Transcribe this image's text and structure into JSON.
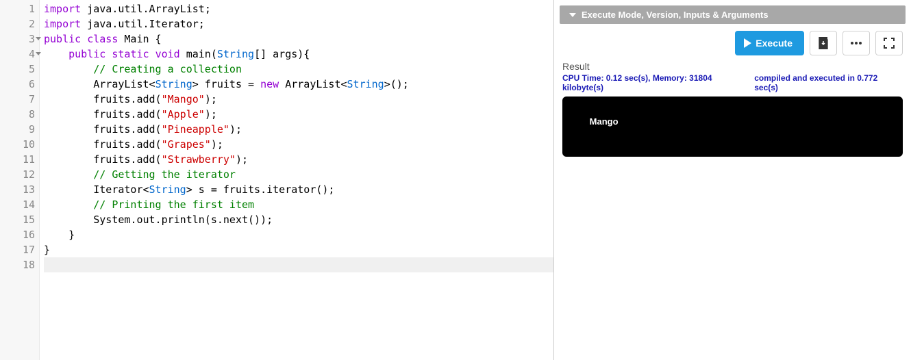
{
  "editor": {
    "lines": [
      {
        "n": "1",
        "fold": false,
        "tokens": [
          {
            "c": "kw-import",
            "t": "import"
          },
          {
            "c": "pn",
            "t": " "
          },
          {
            "c": "pkg",
            "t": "java.util.ArrayList"
          },
          {
            "c": "pn",
            "t": ";"
          }
        ]
      },
      {
        "n": "2",
        "fold": false,
        "tokens": [
          {
            "c": "kw-import",
            "t": "import"
          },
          {
            "c": "pn",
            "t": " "
          },
          {
            "c": "pkg",
            "t": "java.util.Iterator"
          },
          {
            "c": "pn",
            "t": ";"
          }
        ]
      },
      {
        "n": "3",
        "fold": true,
        "tokens": [
          {
            "c": "kw-purple",
            "t": "public"
          },
          {
            "c": "pn",
            "t": " "
          },
          {
            "c": "kw-purple",
            "t": "class"
          },
          {
            "c": "pn",
            "t": " "
          },
          {
            "c": "classname",
            "t": "Main"
          },
          {
            "c": "pn",
            "t": " {"
          }
        ]
      },
      {
        "n": "4",
        "fold": true,
        "tokens": [
          {
            "c": "pn",
            "t": "    "
          },
          {
            "c": "kw-purple",
            "t": "public"
          },
          {
            "c": "pn",
            "t": " "
          },
          {
            "c": "kw-purple",
            "t": "static"
          },
          {
            "c": "pn",
            "t": " "
          },
          {
            "c": "t-void",
            "t": "void"
          },
          {
            "c": "pn",
            "t": " "
          },
          {
            "c": "fn",
            "t": "main"
          },
          {
            "c": "pn",
            "t": "("
          },
          {
            "c": "type",
            "t": "String"
          },
          {
            "c": "pn",
            "t": "[] args){"
          }
        ]
      },
      {
        "n": "5",
        "fold": false,
        "tokens": [
          {
            "c": "pn",
            "t": "        "
          },
          {
            "c": "cmt",
            "t": "// Creating a collection"
          }
        ]
      },
      {
        "n": "6",
        "fold": false,
        "tokens": [
          {
            "c": "pn",
            "t": "        "
          },
          {
            "c": "ident",
            "t": "ArrayList"
          },
          {
            "c": "pn",
            "t": "<"
          },
          {
            "c": "type",
            "t": "String"
          },
          {
            "c": "pn",
            "t": "> fruits = "
          },
          {
            "c": "kw-new",
            "t": "new"
          },
          {
            "c": "pn",
            "t": " "
          },
          {
            "c": "ident",
            "t": "ArrayList"
          },
          {
            "c": "pn",
            "t": "<"
          },
          {
            "c": "type",
            "t": "String"
          },
          {
            "c": "pn",
            "t": ">();"
          }
        ]
      },
      {
        "n": "7",
        "fold": false,
        "tokens": [
          {
            "c": "pn",
            "t": "        fruits.add("
          },
          {
            "c": "str",
            "t": "\"Mango\""
          },
          {
            "c": "pn",
            "t": ");"
          }
        ]
      },
      {
        "n": "8",
        "fold": false,
        "tokens": [
          {
            "c": "pn",
            "t": "        fruits.add("
          },
          {
            "c": "str",
            "t": "\"Apple\""
          },
          {
            "c": "pn",
            "t": ");"
          }
        ]
      },
      {
        "n": "9",
        "fold": false,
        "tokens": [
          {
            "c": "pn",
            "t": "        fruits.add("
          },
          {
            "c": "str",
            "t": "\"Pineapple\""
          },
          {
            "c": "pn",
            "t": ");"
          }
        ]
      },
      {
        "n": "10",
        "fold": false,
        "tokens": [
          {
            "c": "pn",
            "t": "        fruits.add("
          },
          {
            "c": "str",
            "t": "\"Grapes\""
          },
          {
            "c": "pn",
            "t": ");"
          }
        ]
      },
      {
        "n": "11",
        "fold": false,
        "tokens": [
          {
            "c": "pn",
            "t": "        fruits.add("
          },
          {
            "c": "str",
            "t": "\"Strawberry\""
          },
          {
            "c": "pn",
            "t": ");"
          }
        ]
      },
      {
        "n": "12",
        "fold": false,
        "tokens": [
          {
            "c": "pn",
            "t": "        "
          },
          {
            "c": "cmt",
            "t": "// Getting the iterator"
          }
        ]
      },
      {
        "n": "13",
        "fold": false,
        "tokens": [
          {
            "c": "pn",
            "t": "        "
          },
          {
            "c": "ident",
            "t": "Iterator"
          },
          {
            "c": "pn",
            "t": "<"
          },
          {
            "c": "type",
            "t": "String"
          },
          {
            "c": "pn",
            "t": "> s = fruits.iterator();"
          }
        ]
      },
      {
        "n": "14",
        "fold": false,
        "tokens": [
          {
            "c": "pn",
            "t": "        "
          },
          {
            "c": "cmt",
            "t": "// Printing the first item"
          }
        ]
      },
      {
        "n": "15",
        "fold": false,
        "tokens": [
          {
            "c": "pn",
            "t": "        "
          },
          {
            "c": "ident",
            "t": "System"
          },
          {
            "c": "pn",
            "t": ".out.println(s.next());"
          }
        ]
      },
      {
        "n": "16",
        "fold": false,
        "tokens": [
          {
            "c": "pn",
            "t": "    }"
          }
        ]
      },
      {
        "n": "17",
        "fold": false,
        "tokens": [
          {
            "c": "pn",
            "t": "}"
          }
        ]
      },
      {
        "n": "18",
        "fold": false,
        "current": true,
        "tokens": [
          {
            "c": "pn",
            "t": ""
          }
        ]
      }
    ]
  },
  "right": {
    "panel_title": "Execute Mode, Version, Inputs & Arguments",
    "execute_label": "Execute",
    "result_label": "Result",
    "stats_left": "CPU Time: 0.12 sec(s), Memory: 31804 kilobyte(s)",
    "stats_right": "compiled and executed in 0.772 sec(s)",
    "console_output": "Mango"
  }
}
